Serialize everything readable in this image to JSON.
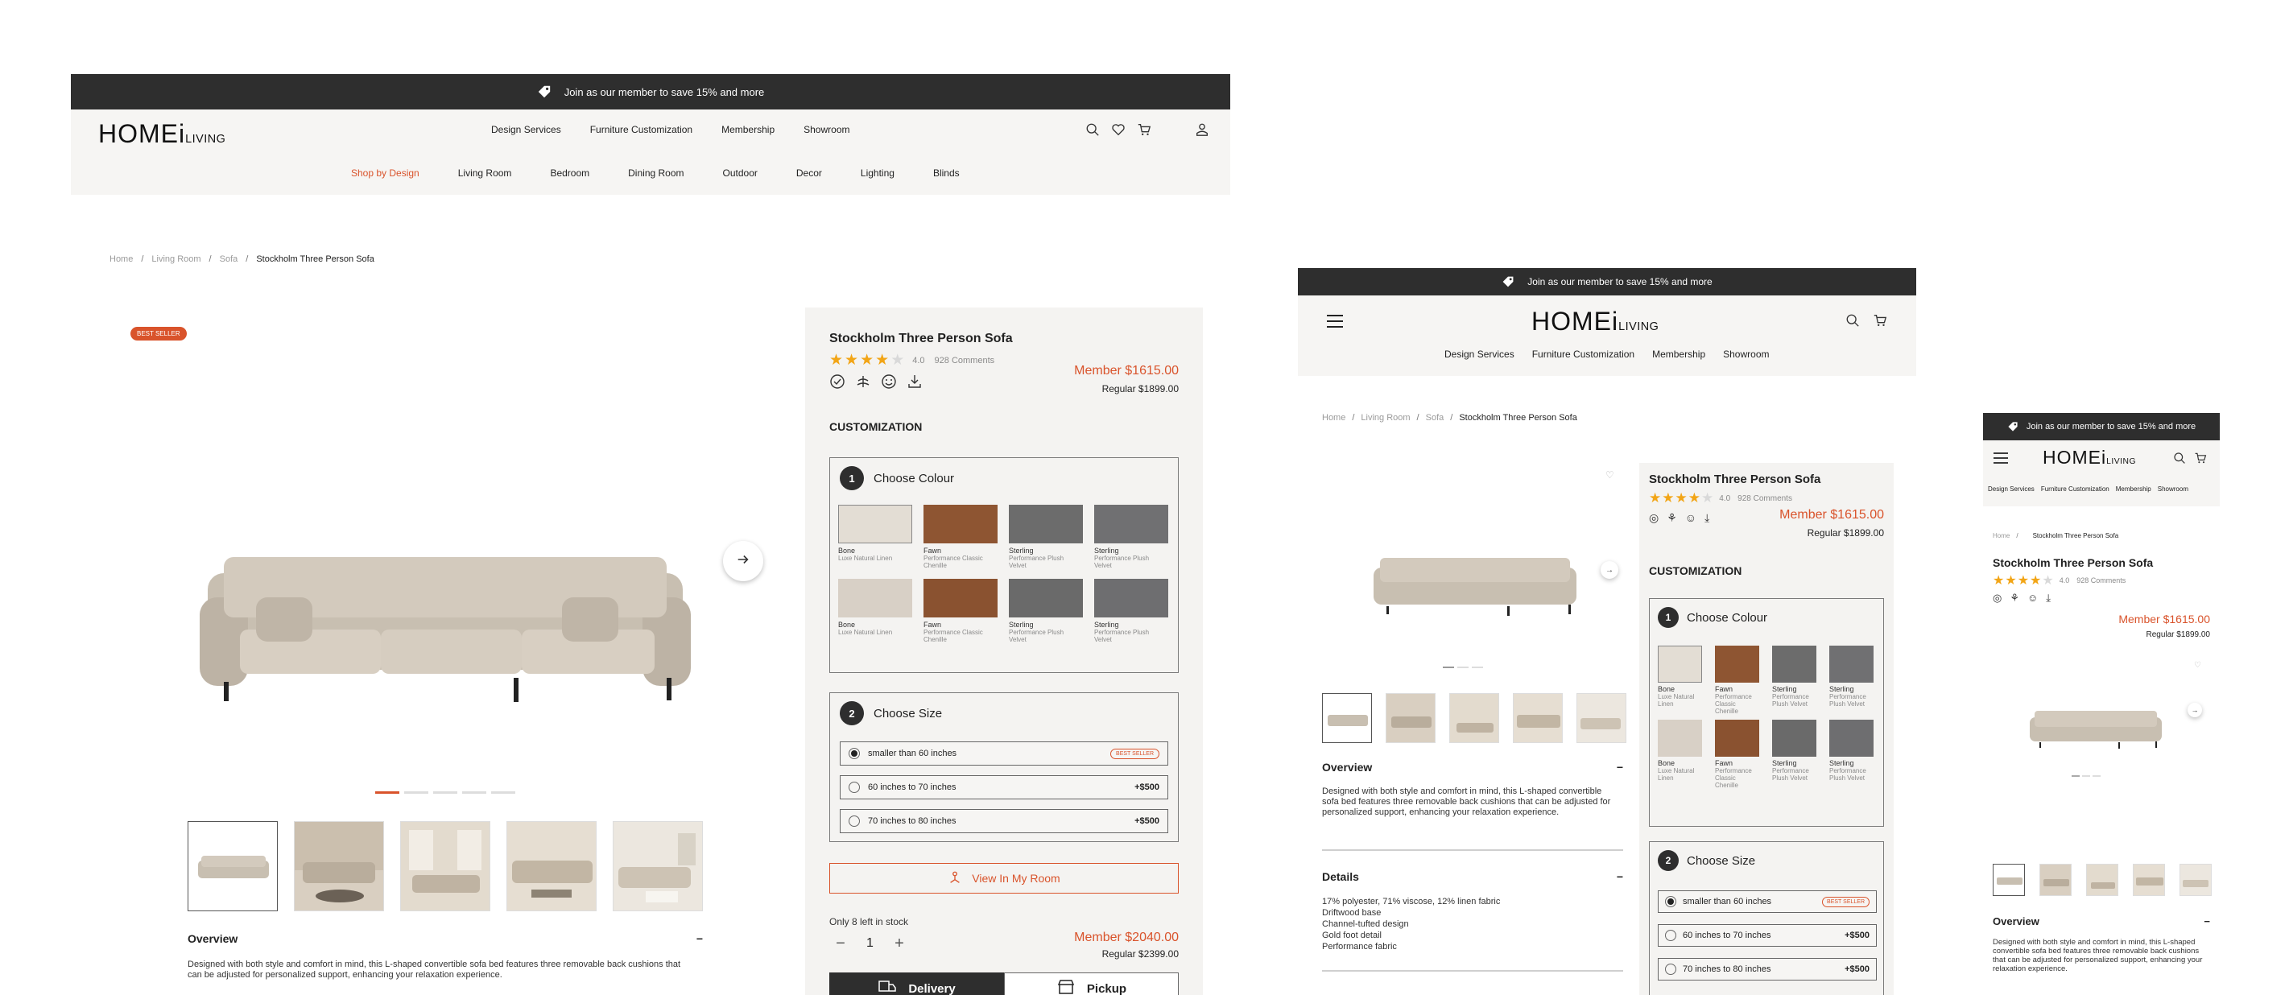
{
  "banner": {
    "text": "Join as our member to save 15% and more"
  },
  "logo": {
    "main": "HOMEi",
    "sub": "LIVING"
  },
  "nav": {
    "items": [
      "Design Services",
      "Furniture Customization",
      "Membership",
      "Showroom"
    ]
  },
  "subnav": {
    "items": [
      "Shop by Design",
      "Living Room",
      "Bedroom",
      "Dining Room",
      "Outdoor",
      "Decor",
      "Lighting",
      "Blinds"
    ]
  },
  "breadcrumb": {
    "home": "Home",
    "living": "Living Room",
    "sofa": "Sofa",
    "current": "Stockholm Three Person Sofa",
    "sep": "/"
  },
  "badge": {
    "best_seller": "BEST SELLER"
  },
  "product": {
    "title": "Stockholm Three Person Sofa",
    "rating": "4.0",
    "rating_value": 4,
    "comments": "928 Comments",
    "member_price": "Member $1615.00",
    "regular_price": "Regular $1899.00"
  },
  "customization": {
    "heading": "CUSTOMIZATION"
  },
  "colour": {
    "step": "1",
    "title": "Choose Colour",
    "swatches": [
      {
        "name": "Bone",
        "type": "Luxe Natural Linen",
        "color": "#e3ddd4"
      },
      {
        "name": "Fawn",
        "type": "Performance Classic Chenille",
        "color": "#8e5532"
      },
      {
        "name": "Sterling",
        "type": "Performance Plush Velvet",
        "color": "#6c6c6c"
      },
      {
        "name": "Sterling",
        "type": "Performance Plush Velvet",
        "color": "#707072"
      },
      {
        "name": "Bone",
        "type": "Luxe Natural Linen",
        "color": "#d8d0c6"
      },
      {
        "name": "Fawn",
        "type": "Performance Classic Chenille",
        "color": "#8a5230"
      },
      {
        "name": "Sterling",
        "type": "Performance Plush Velvet",
        "color": "#6a6a6a"
      },
      {
        "name": "Sterling",
        "type": "Performance Plush Velvet",
        "color": "#6e6e70"
      }
    ]
  },
  "size": {
    "step": "2",
    "title": "Choose Size",
    "options": [
      {
        "label": "smaller than 60 inches",
        "extra": "BEST SELLER"
      },
      {
        "label": "60 inches to 70 inches",
        "extra": "+$500"
      },
      {
        "label": "70 inches to 80 inches",
        "extra": "+$500"
      }
    ]
  },
  "view_room": {
    "label": "View In My Room"
  },
  "stock": {
    "text": "Only 8 left in stock",
    "qty": "1",
    "minus": "−",
    "plus": "+"
  },
  "total": {
    "member": "Member $2040.00",
    "regular": "Regular $2399.00"
  },
  "tabs": {
    "delivery": "Delivery",
    "pickup": "Pickup"
  },
  "overview": {
    "title": "Overview",
    "toggle": "−",
    "text": "Designed with both style and comfort in mind, this L-shaped convertible sofa bed features three removable back cushions that can be adjusted for personalized support, enhancing your relaxation experience."
  },
  "details": {
    "title": "Details",
    "toggle": "−",
    "lines": [
      "17% polyester, 71% viscose, 12% linen fabric",
      "Driftwood base",
      "Channel-tufted design",
      "Gold foot detail",
      "Performance fabric"
    ]
  },
  "colors": {
    "accent": "#d9532b",
    "dark": "#2e2e2e",
    "panel": "#f4f3f1",
    "star": "#f2a516"
  },
  "icons": [
    "tag-icon",
    "search-icon",
    "heart-icon",
    "cart-icon",
    "user-icon",
    "menu-icon",
    "arrow-right-icon",
    "check-badge-icon",
    "eco-icon",
    "smile-icon",
    "download-icon",
    "ar-icon",
    "truck-icon",
    "store-icon"
  ]
}
